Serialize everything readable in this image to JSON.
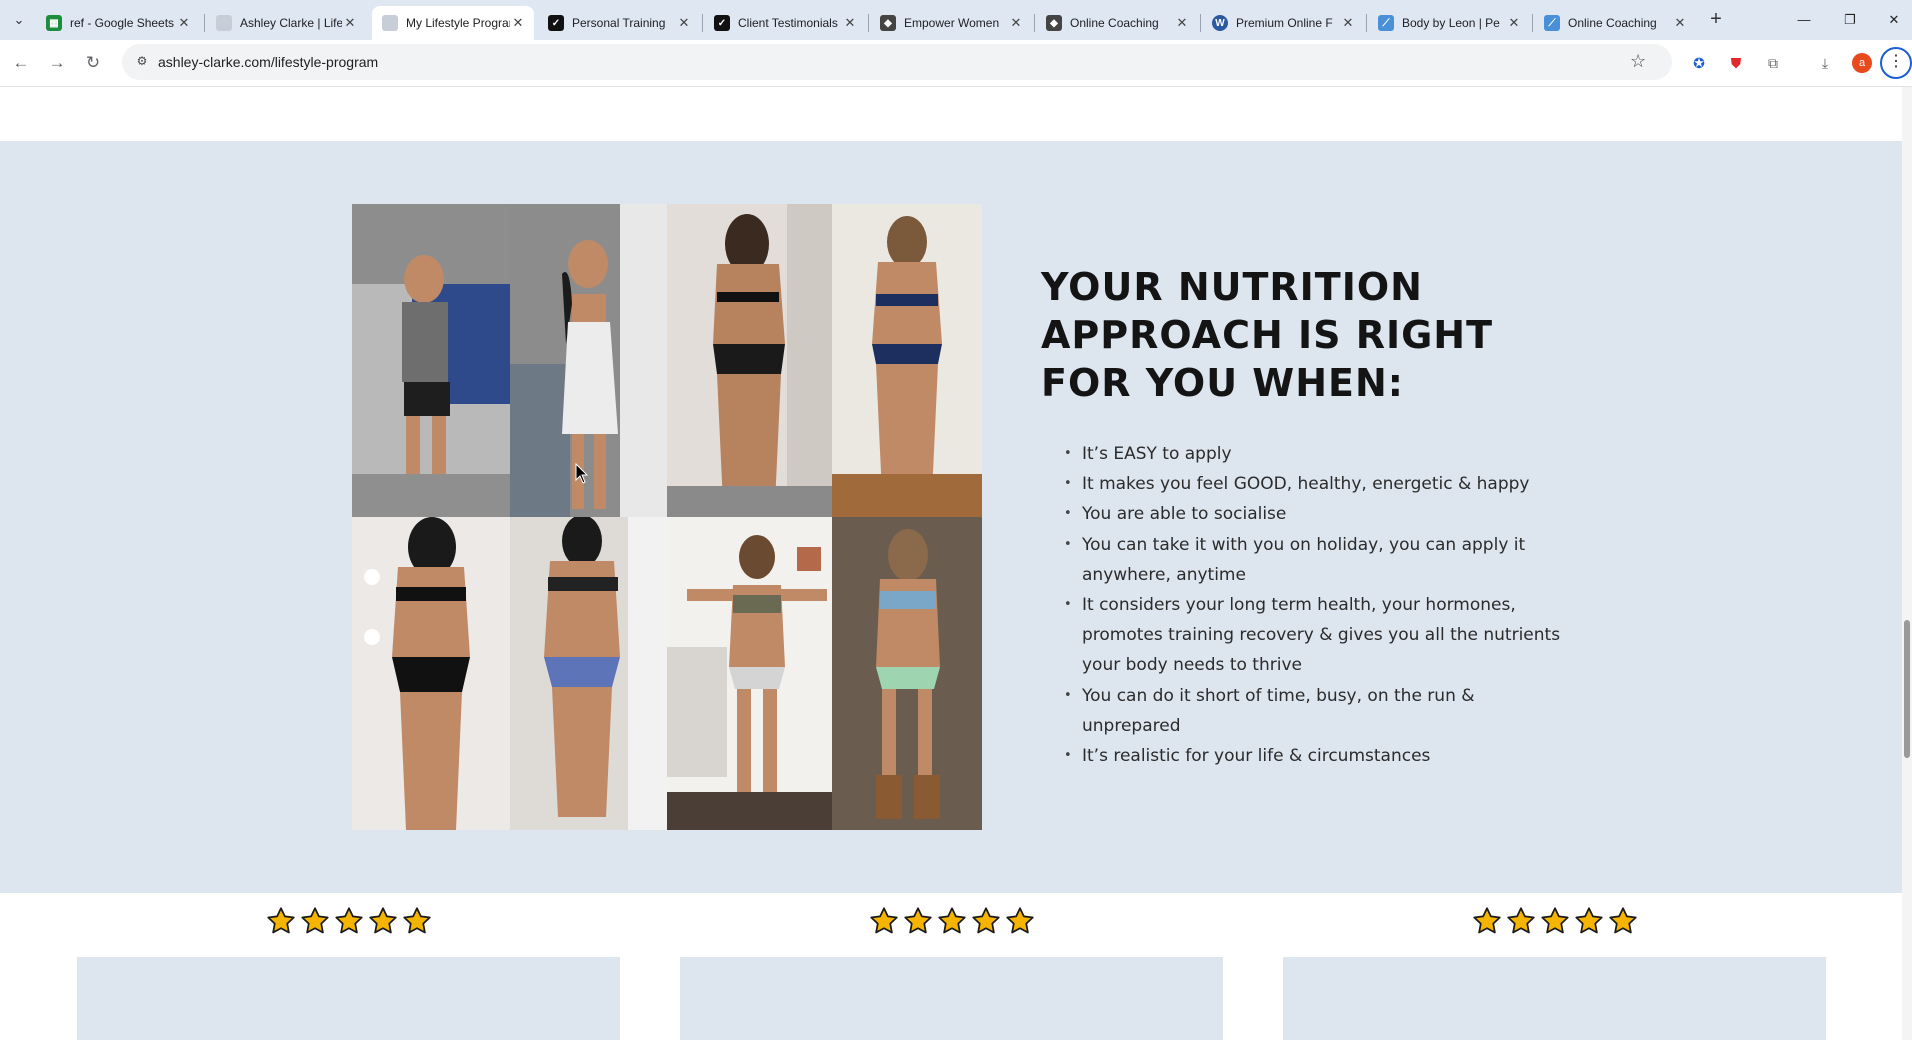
{
  "browser": {
    "tabs": [
      {
        "title": "ref - Google Sheets",
        "favicon": "sheets-icon",
        "color": "#1e8e3e"
      },
      {
        "title": "Ashley Clarke | Lifestyle",
        "favicon": "blank-page-icon",
        "color": "#c8ced8"
      },
      {
        "title": "My Lifestyle Program",
        "favicon": "blank-page-icon",
        "color": "#c8ced8",
        "active": true
      },
      {
        "title": "Personal Training",
        "favicon": "checkmark-logo-icon",
        "color": "#111111"
      },
      {
        "title": "Client Testimonials",
        "favicon": "checkmark-logo-icon",
        "color": "#111111"
      },
      {
        "title": "Empower Women",
        "favicon": "cube-icon",
        "color": "#444444"
      },
      {
        "title": "Online Coaching",
        "favicon": "cube-icon",
        "color": "#444444"
      },
      {
        "title": "Premium Online F",
        "favicon": "wordpress-icon",
        "color": "#2b5aa0"
      },
      {
        "title": "Body by Leon | Pe",
        "favicon": "feather-icon",
        "color": "#4a90d9"
      },
      {
        "title": "Online Coaching",
        "favicon": "feather-icon",
        "color": "#4a90d9"
      }
    ],
    "url": "ashley-clarke.com/lifestyle-program",
    "profile_initial": "a"
  },
  "section": {
    "heading": "YOUR NUTRITION APPROACH IS RIGHT FOR YOU WHEN:",
    "bullets": [
      "It’s EASY to apply",
      "It makes you feel GOOD, healthy, energetic & happy",
      "You are able to socialise",
      "You can take it with you on holiday, you can apply it anywhere, anytime",
      "It considers your long term health, your hormones, promotes training recovery & gives you all the nutrients your body needs to thrive",
      "You can do it short of time, busy, on the run & unprepared",
      "It’s realistic for your life & circumstances"
    ]
  },
  "testimonials": [
    {
      "rating": 5,
      "max": 5
    },
    {
      "rating": 5,
      "max": 5
    },
    {
      "rating": 5,
      "max": 5
    }
  ],
  "colors": {
    "band": "#dde5ef",
    "star_fill": "#f4b400",
    "heading": "#141414"
  }
}
